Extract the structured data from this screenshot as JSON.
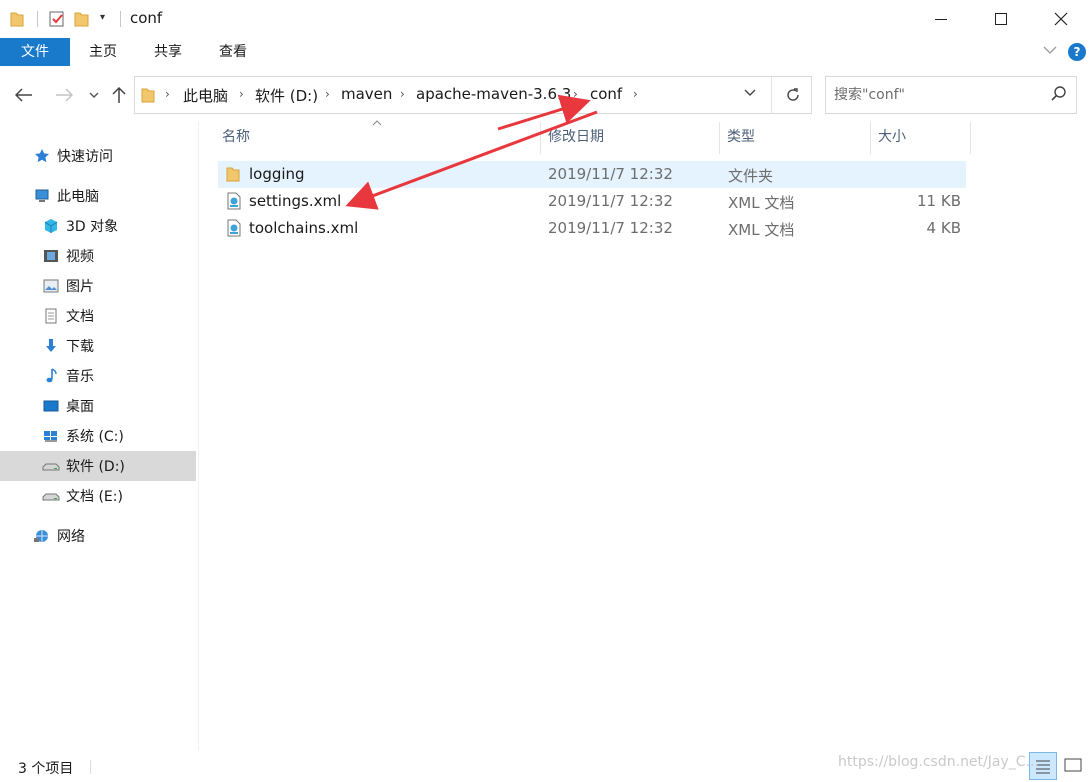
{
  "window": {
    "title": "conf"
  },
  "ribbon": {
    "tabs": [
      "文件",
      "主页",
      "共享",
      "查看"
    ],
    "help": "?"
  },
  "address": {
    "crumbs": [
      "此电脑",
      "软件 (D:)",
      "maven",
      "apache-maven-3.6.3",
      "conf"
    ]
  },
  "search": {
    "placeholder": "搜索\"conf\""
  },
  "nav_pane": {
    "items": [
      {
        "label": "快速访问",
        "icon": "quick-access-star-icon"
      },
      {
        "label": "此电脑",
        "icon": "this-pc-icon"
      },
      {
        "label": "3D 对象",
        "icon": "3d-objects-icon"
      },
      {
        "label": "视频",
        "icon": "videos-icon"
      },
      {
        "label": "图片",
        "icon": "pictures-icon"
      },
      {
        "label": "文档",
        "icon": "documents-icon"
      },
      {
        "label": "下载",
        "icon": "downloads-icon"
      },
      {
        "label": "音乐",
        "icon": "music-icon"
      },
      {
        "label": "桌面",
        "icon": "desktop-icon"
      },
      {
        "label": "系统 (C:)",
        "icon": "system-drive-icon"
      },
      {
        "label": "软件 (D:)",
        "icon": "drive-icon",
        "selected": true
      },
      {
        "label": "文档 (E:)",
        "icon": "drive-icon"
      },
      {
        "label": "网络",
        "icon": "network-icon"
      }
    ]
  },
  "file_list": {
    "columns": {
      "name": "名称",
      "date": "修改日期",
      "type": "类型",
      "size": "大小"
    },
    "rows": [
      {
        "name": "logging",
        "date": "2019/11/7 12:32",
        "type": "文件夹",
        "size": "",
        "icon": "folder-icon",
        "highlighted": true
      },
      {
        "name": "settings.xml",
        "date": "2019/11/7 12:32",
        "type": "XML 文档",
        "size": "11 KB",
        "icon": "xml-file-icon"
      },
      {
        "name": "toolchains.xml",
        "date": "2019/11/7 12:32",
        "type": "XML 文档",
        "size": "4 KB",
        "icon": "xml-file-icon"
      }
    ]
  },
  "status": {
    "count": "3 个项目"
  },
  "watermark": "https://blog.csdn.net/Jay_C...",
  "colors": {
    "accent": "#1979ca",
    "selection": "#e5f3ff",
    "nav_selected": "#d9d9d9",
    "arrow": "#e8383d"
  }
}
